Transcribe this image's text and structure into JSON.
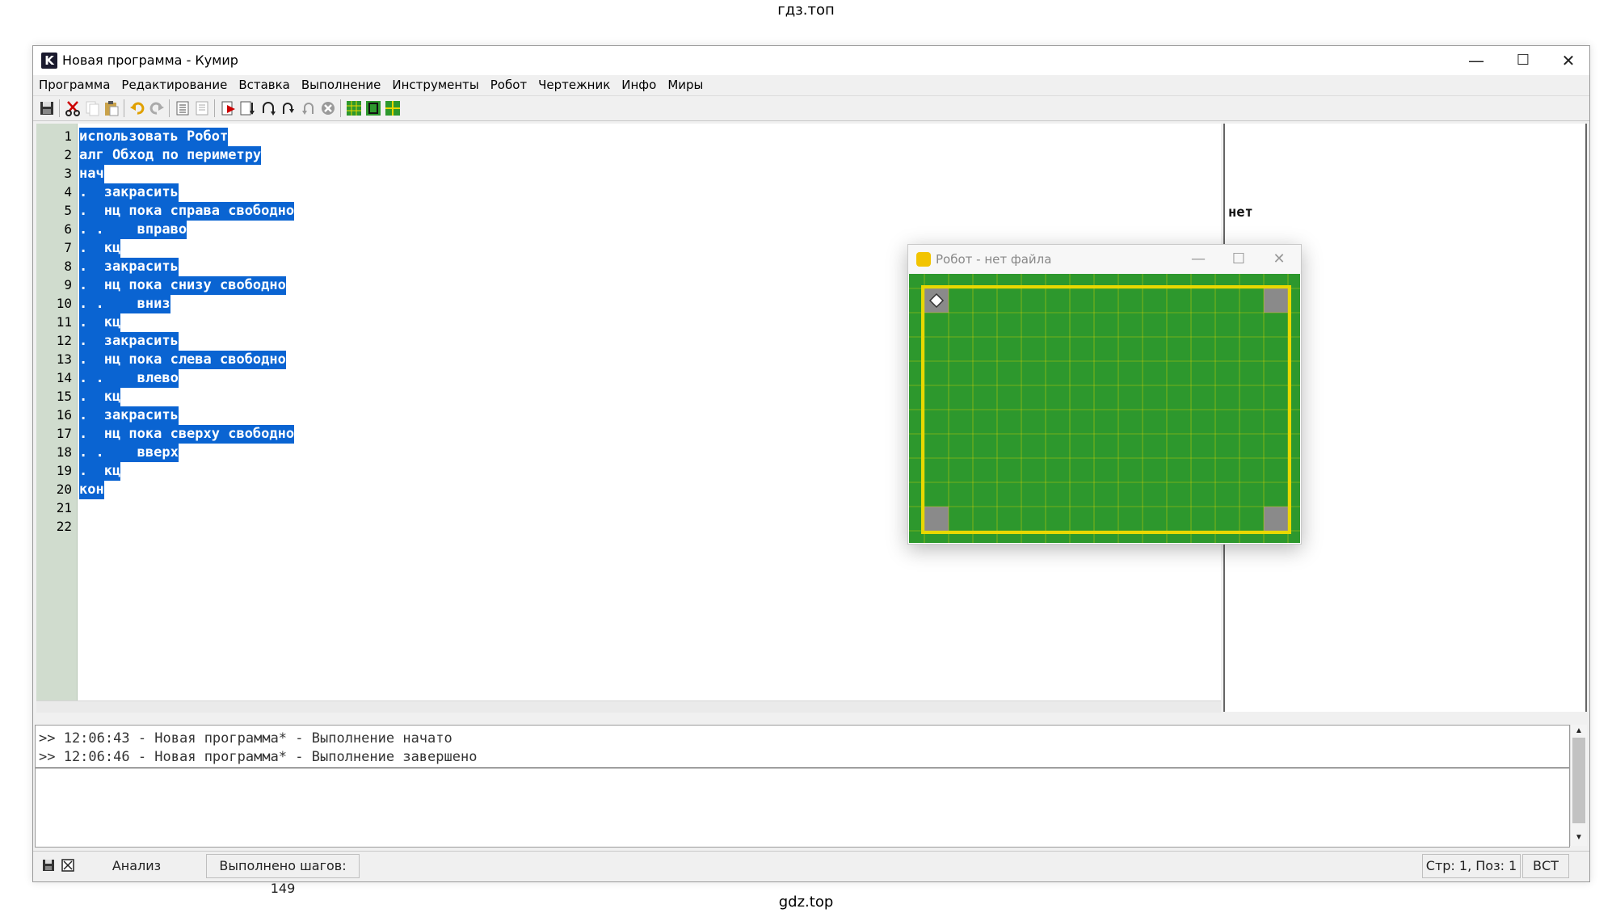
{
  "watermarks": {
    "top": "гдз.топ",
    "bottom": "gdz.top"
  },
  "window": {
    "title": "Новая программа - Кумир",
    "app_letter": "K",
    "minimize": "—",
    "maximize": "☐",
    "close": "✕"
  },
  "menu": [
    "Программа",
    "Редактирование",
    "Вставка",
    "Выполнение",
    "Инструменты",
    "Робот",
    "Чертежник",
    "Инфо",
    "Миры"
  ],
  "editor": {
    "line_numbers": [
      "1",
      "2",
      "3",
      "4",
      "5",
      "6",
      "7",
      "8",
      "9",
      "10",
      "11",
      "12",
      "13",
      "14",
      "15",
      "16",
      "17",
      "18",
      "19",
      "20",
      "21",
      "22"
    ],
    "lines": [
      "использовать Робот",
      "алг Обход по периметру",
      "нач",
      ".  закрасить",
      ".  нц пока справа свободно",
      ". .    вправо",
      ".  кц",
      ".  закрасить",
      ".  нц пока снизу свободно",
      ". .    вниз",
      ".  кц",
      ".  закрасить",
      ".  нц пока слева свободно",
      ". .    влево",
      ".  кц",
      ".  закрасить",
      ".  нц пока сверху свободно",
      ". .    вверх",
      ".  кц",
      "кон",
      "",
      ""
    ]
  },
  "side_panel": {
    "value": "нет"
  },
  "console": {
    "lines": [
      ">> 12:06:43 - Новая программа* - Выполнение начато",
      ">> 12:06:46 - Новая программа* - Выполнение завершено"
    ]
  },
  "status": {
    "mode": "Анализ",
    "steps": "Выполнено шагов: 149",
    "position": "Стр: 1, Поз: 1",
    "insert_mode": "ВСТ"
  },
  "robot_window": {
    "title": "Робот - нет файла",
    "grid_cols": 15,
    "grid_rows": 10,
    "painted_cells": [
      [
        0,
        0
      ],
      [
        14,
        0
      ],
      [
        0,
        9
      ],
      [
        14,
        9
      ]
    ],
    "robot_cell": [
      0,
      0
    ]
  },
  "colors": {
    "selection": "#0a64d2",
    "field": "#2d982d",
    "wall": "#e8d800",
    "painted": "#8a8a8a",
    "gutter": "#d0dcce"
  },
  "toolbar_icons": [
    "save-icon",
    "cut-icon",
    "copy-icon",
    "paste-icon",
    "undo-icon",
    "redo-icon",
    "indent-icon",
    "unindent-icon",
    "run-icon",
    "step-icon",
    "step-into-icon",
    "step-out-icon",
    "step-back-icon",
    "stop-icon",
    "robot-field-icon",
    "drawer-icon",
    "grid-icon"
  ]
}
